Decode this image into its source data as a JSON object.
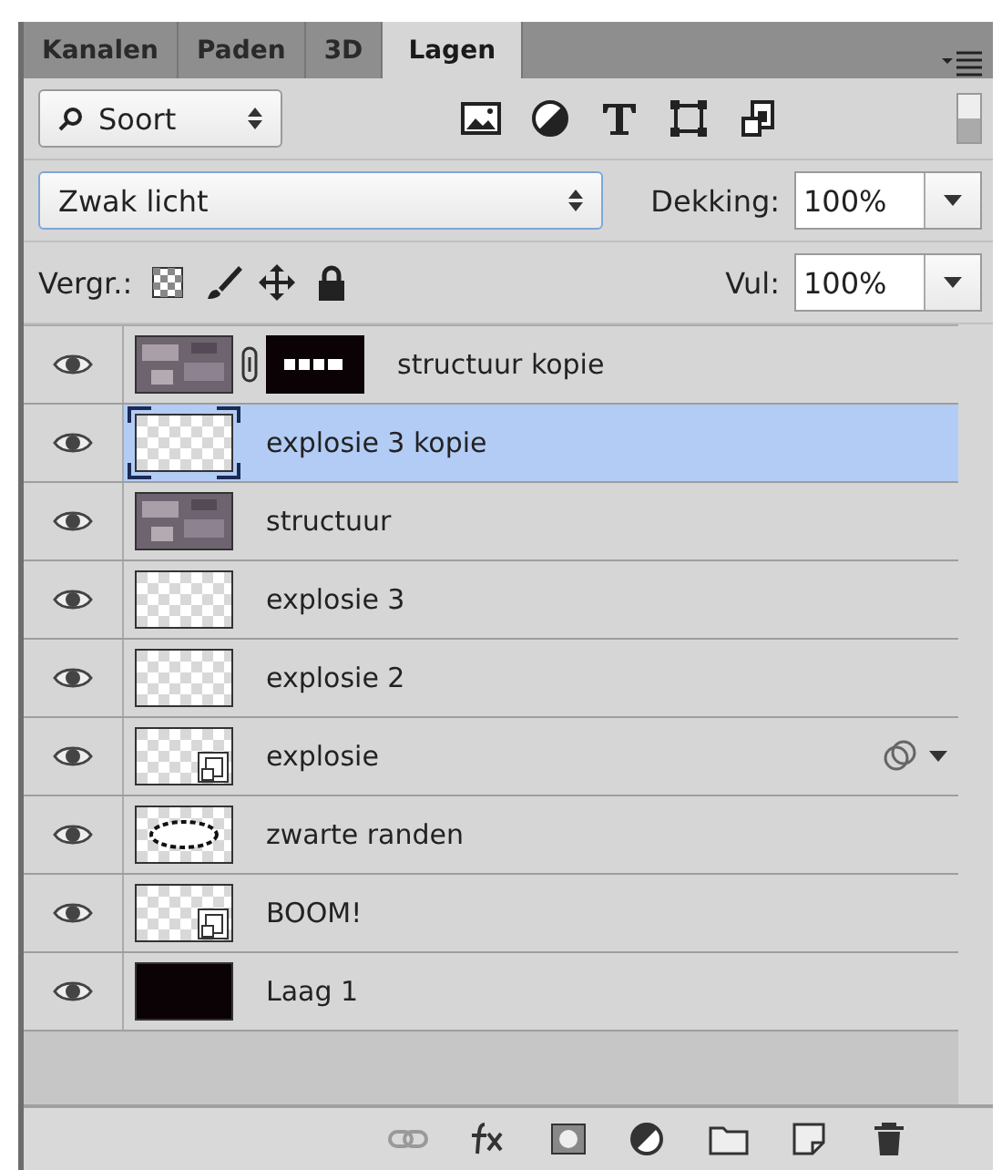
{
  "tabs": [
    {
      "label": "Kanalen",
      "selected": false
    },
    {
      "label": "Paden",
      "selected": false
    },
    {
      "label": "3D",
      "selected": false
    },
    {
      "label": "Lagen",
      "selected": true
    }
  ],
  "filter": {
    "value": "Soort"
  },
  "blend_mode": {
    "value": "Zwak licht"
  },
  "opacity": {
    "label": "Dekking:",
    "value": "100%"
  },
  "lock": {
    "label": "Vergr.:"
  },
  "fill": {
    "label": "Vul:",
    "value": "100%"
  },
  "layers": [
    {
      "name": "structuur kopie",
      "visible": true,
      "selected": false,
      "kind": "texture",
      "mask": true,
      "effects": false
    },
    {
      "name": "explosie 3 kopie",
      "visible": true,
      "selected": true,
      "kind": "transparent",
      "mask": false,
      "effects": false
    },
    {
      "name": "structuur",
      "visible": true,
      "selected": false,
      "kind": "texture",
      "mask": false,
      "effects": false
    },
    {
      "name": "explosie 3",
      "visible": true,
      "selected": false,
      "kind": "transparent",
      "mask": false,
      "effects": false
    },
    {
      "name": "explosie 2",
      "visible": true,
      "selected": false,
      "kind": "transparent",
      "mask": false,
      "effects": false
    },
    {
      "name": "explosie",
      "visible": true,
      "selected": false,
      "kind": "smart",
      "mask": false,
      "effects": true
    },
    {
      "name": "zwarte randen",
      "visible": true,
      "selected": false,
      "kind": "outline",
      "mask": false,
      "effects": false
    },
    {
      "name": "BOOM!",
      "visible": true,
      "selected": false,
      "kind": "smart",
      "mask": false,
      "effects": false
    },
    {
      "name": "Laag 1",
      "visible": true,
      "selected": false,
      "kind": "black",
      "mask": false,
      "effects": false
    }
  ]
}
